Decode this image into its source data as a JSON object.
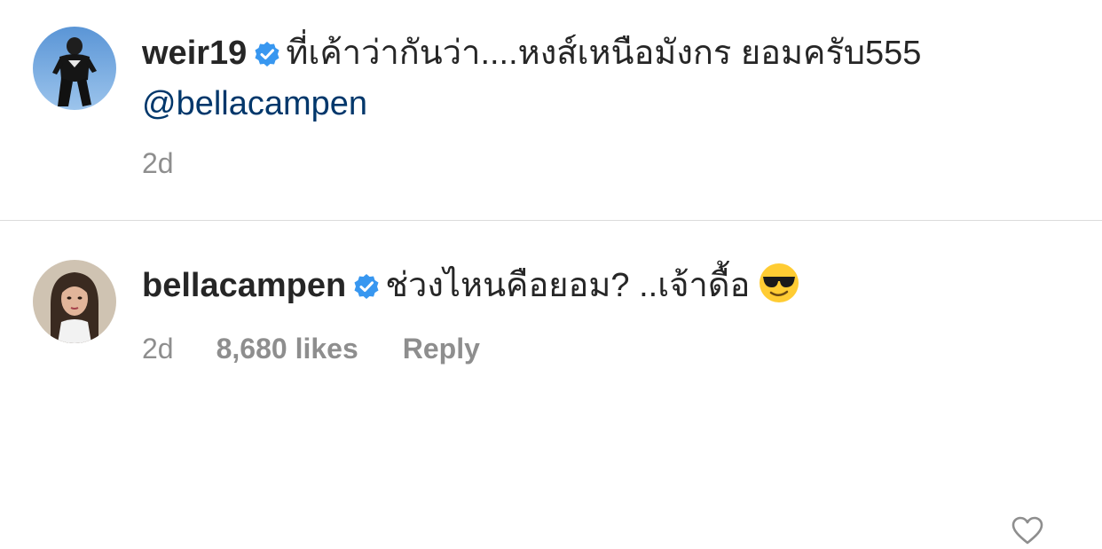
{
  "comments": [
    {
      "username": "weir19",
      "verified": true,
      "text": "ที่เค้าว่ากันว่า....หงส์เหนือมังกร ยอมครับ555 ",
      "mention": "@bellacampen",
      "time": "2d"
    },
    {
      "username": "bellacampen",
      "verified": true,
      "text": "ช่วงไหนคือยอม? ..เจ้าดื้อ",
      "emoji": "smiling-face-with-sunglasses",
      "time": "2d",
      "likes": "8,680 likes",
      "reply_label": "Reply"
    }
  ],
  "colors": {
    "text": "#262626",
    "meta": "#8e8e8e",
    "mention": "#00376b",
    "verified": "#3897f0",
    "divider": "#dbdbdb"
  }
}
